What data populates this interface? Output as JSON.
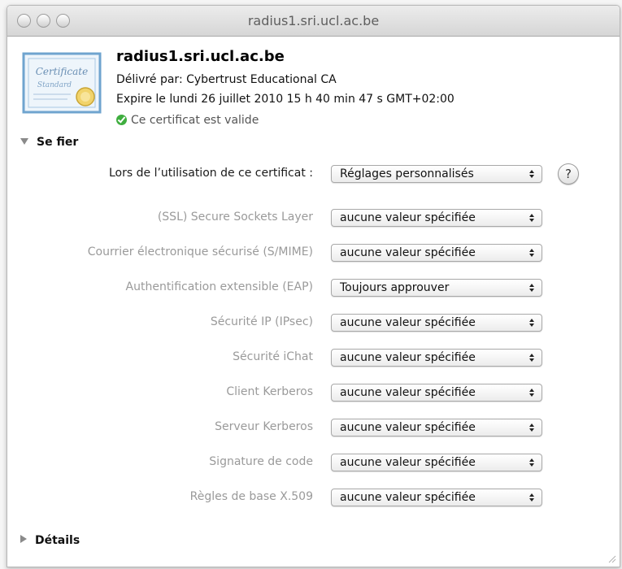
{
  "window": {
    "title": "radius1.sri.ucl.ac.be"
  },
  "certificate": {
    "icon": "certificate-icon",
    "icon_text_top": "Certificate",
    "icon_text_bottom": "Standard",
    "name": "radius1.sri.ucl.ac.be",
    "issued_by": "Délivré par: Cybertrust Educational CA",
    "expires": "Expire le lundi 26 juillet 2010 15 h 40 min 47 s GMT+02:00",
    "status": "Ce certificat est valide",
    "status_color": "#3fae3f"
  },
  "trust": {
    "section_label": "Se fier",
    "expanded": true,
    "main_label": "Lors de l’utilisation de ce certificat :",
    "main_value": "Réglages personnalisés",
    "help_label": "?",
    "rows": [
      {
        "label": "(SSL) Secure Sockets Layer",
        "value": "aucune valeur spécifiée"
      },
      {
        "label": "Courrier électronique sécurisé (S/MIME)",
        "value": "aucune valeur spécifiée"
      },
      {
        "label": "Authentification extensible (EAP)",
        "value": "Toujours approuver"
      },
      {
        "label": "Sécurité IP (IPsec)",
        "value": "aucune valeur spécifiée"
      },
      {
        "label": "Sécurité iChat",
        "value": "aucune valeur spécifiée"
      },
      {
        "label": "Client Kerberos",
        "value": "aucune valeur spécifiée"
      },
      {
        "label": "Serveur Kerberos",
        "value": "aucune valeur spécifiée"
      },
      {
        "label": "Signature de code",
        "value": "aucune valeur spécifiée"
      },
      {
        "label": "Règles de base X.509",
        "value": "aucune valeur spécifiée"
      }
    ]
  },
  "details": {
    "section_label": "Détails",
    "expanded": false
  }
}
